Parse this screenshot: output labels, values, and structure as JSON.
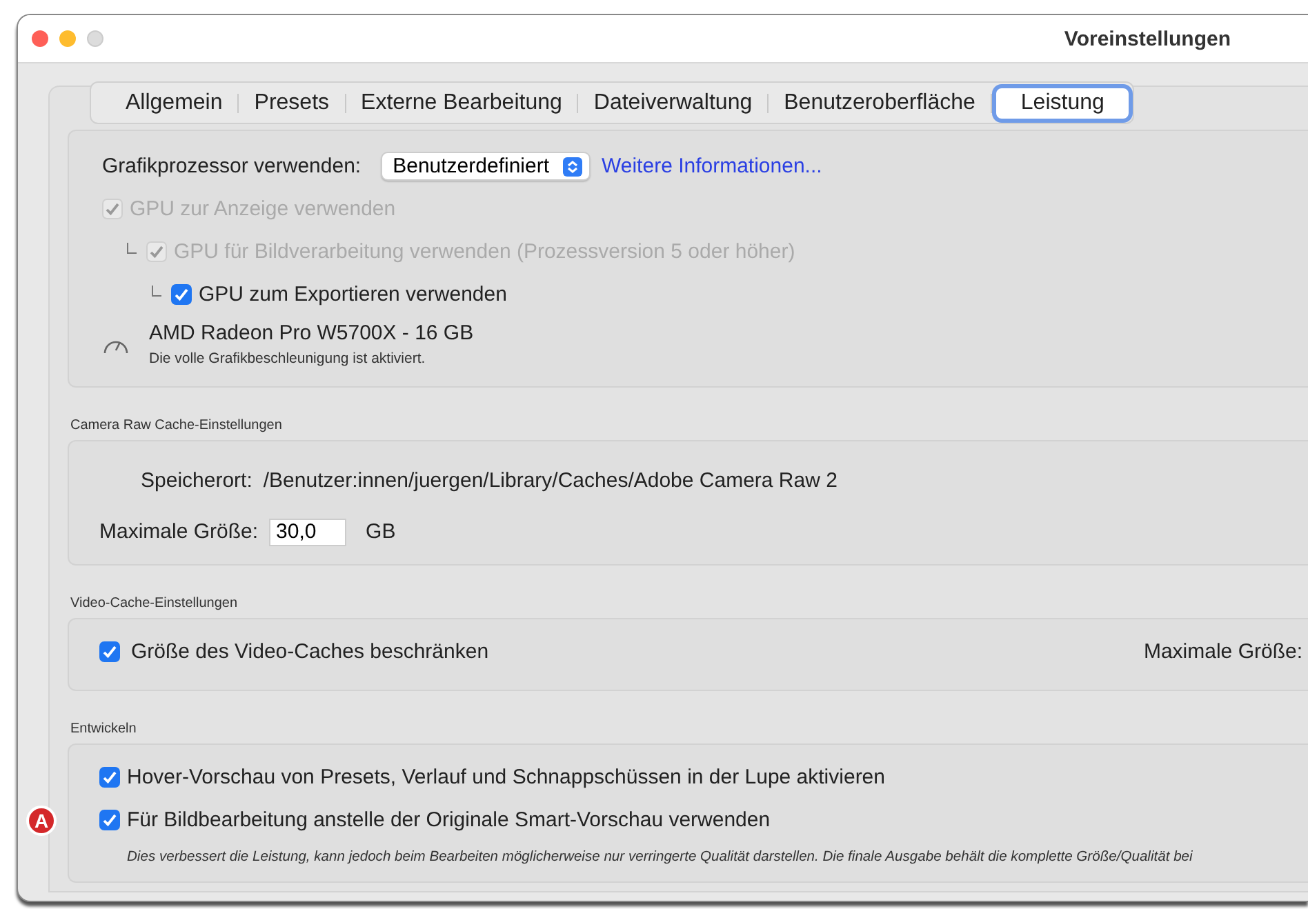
{
  "window": {
    "title": "Voreinstellungen"
  },
  "tabs": [
    {
      "label": "Allgemein",
      "selected": false
    },
    {
      "label": "Presets",
      "selected": false
    },
    {
      "label": "Externe Bearbeitung",
      "selected": false
    },
    {
      "label": "Dateiverwaltung",
      "selected": false
    },
    {
      "label": "Benutzeroberfläche",
      "selected": false
    },
    {
      "label": "Leistung",
      "selected": true
    }
  ],
  "gpu": {
    "label": "Grafikprozessor verwenden:",
    "dropdown": "Benutzerdefiniert",
    "link": "Weitere Informationen...",
    "options": [
      {
        "label": "GPU zur Anzeige verwenden",
        "checked": true,
        "disabled": true,
        "children": [
          {
            "label": "GPU für Bildverarbeitung verwenden (Prozessversion 5 oder höher)",
            "checked": true,
            "disabled": true,
            "children": [
              {
                "label": "GPU zum Exportieren verwenden",
                "checked": true,
                "disabled": false
              }
            ]
          }
        ]
      }
    ],
    "card": "AMD Radeon Pro W5700X - 16 GB",
    "status": "Die volle Grafikbeschleunigung ist aktiviert."
  },
  "camera_raw_cache": {
    "heading": "Camera Raw Cache-Einstellungen",
    "location_label": "Speicherort:",
    "location": "/Benutzer:innen/juergen/Library/Caches/Adobe Camera Raw 2",
    "max_size_label": "Maximale Größe:",
    "max_size": "30,0",
    "unit": "GB"
  },
  "video_cache": {
    "heading": "Video-Cache-Einstellungen",
    "limit": {
      "label": "Größe des Video-Caches beschränken",
      "checked": true
    },
    "max_size_label": "Maximale Größe:"
  },
  "develop": {
    "heading": "Entwickeln",
    "options": [
      {
        "label": "Hover-Vorschau von Presets, Verlauf und Schnappschüssen in der Lupe aktivieren",
        "checked": true
      },
      {
        "label": "Für Bildbearbeitung anstelle der Originale Smart-Vorschau verwenden",
        "checked": true,
        "badge": "A"
      }
    ],
    "note": "Dies verbessert die Leistung, kann jedoch beim Bearbeiten möglicherweise nur verringerte Qualität darstellen. Die finale Ausgabe behält die komplette Größe/Qualität bei"
  }
}
